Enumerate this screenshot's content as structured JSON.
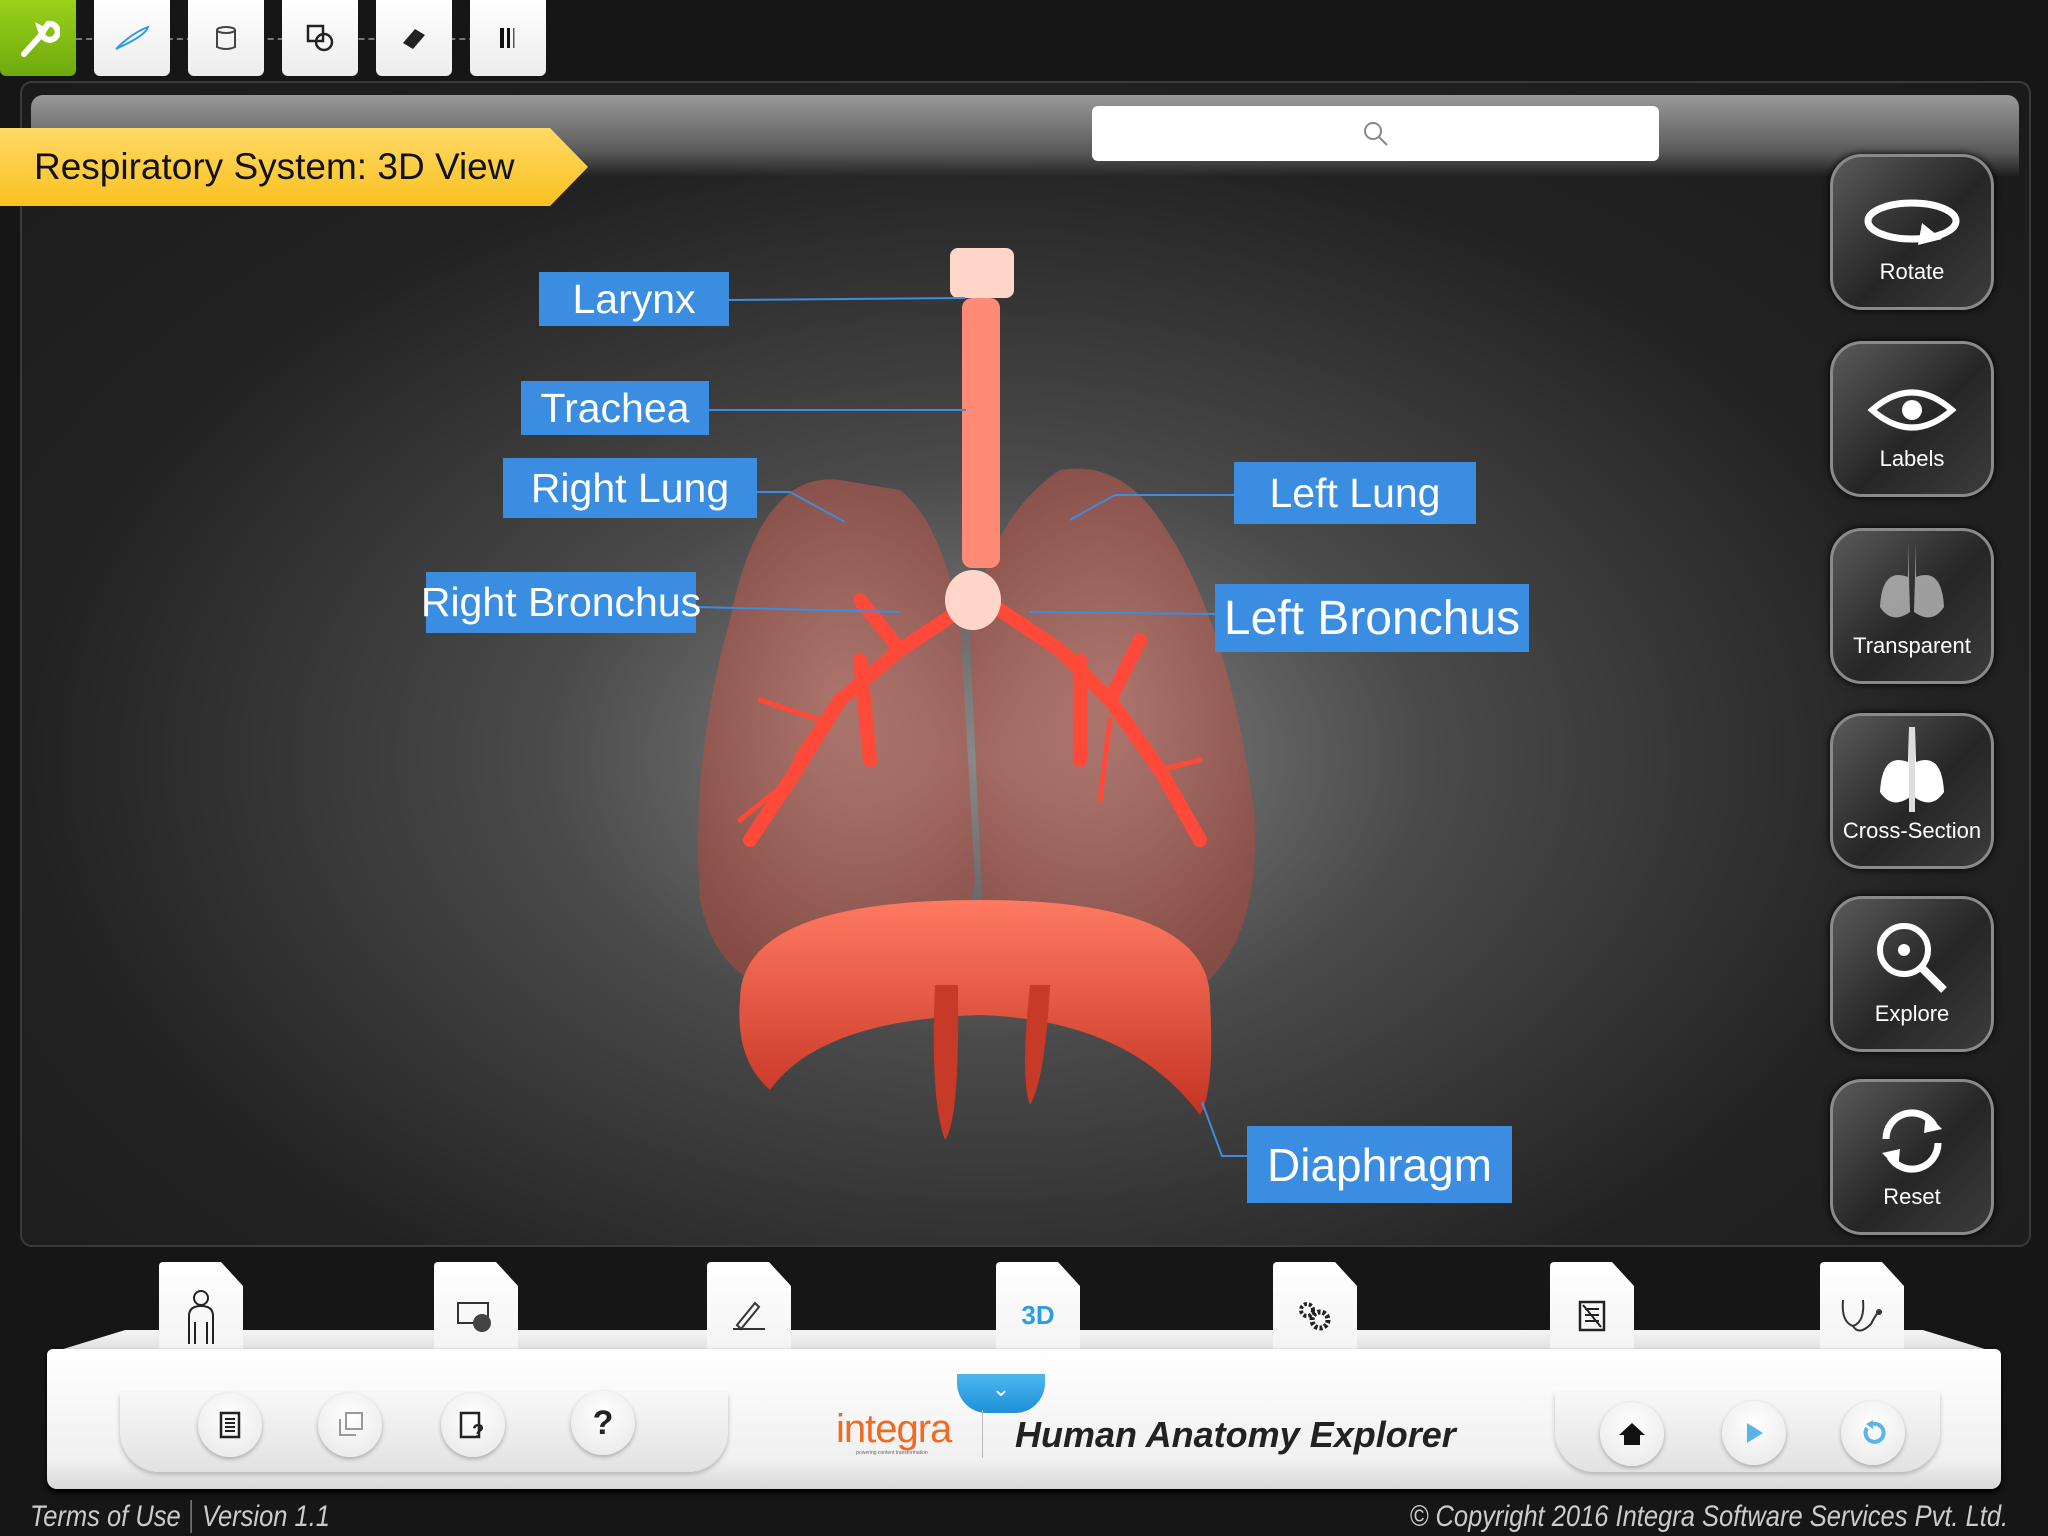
{
  "toolbar": {
    "tools": [
      {
        "icon": "wrench-icon",
        "active": true
      },
      {
        "icon": "pen-icon"
      },
      {
        "icon": "bucket-icon"
      },
      {
        "icon": "shapes-icon"
      },
      {
        "icon": "eraser-icon"
      },
      {
        "icon": "line-width-icon"
      }
    ]
  },
  "header": {
    "title": "Respiratory System: 3D View",
    "search_placeholder": ""
  },
  "labels": {
    "larynx": "Larynx",
    "trachea": "Trachea",
    "right_lung": "Right Lung",
    "right_bronchus": "Right Bronchus",
    "left_lung": "Left Lung",
    "left_bronchus": "Left Bronchus",
    "diaphragm": "Diaphragm"
  },
  "side_buttons": {
    "rotate": "Rotate",
    "labels": "Labels",
    "transparent": "Transparent",
    "cross_section": "Cross-Section",
    "explore": "Explore",
    "reset": "Reset"
  },
  "dock": {
    "tabs": [
      "body-icon",
      "video-icon",
      "write-icon",
      "3D",
      "gears-icon",
      "notes-icon",
      "stethoscope-icon"
    ],
    "tab_3d": "3D",
    "active_tab": "3D",
    "help": "?",
    "logo": "integra",
    "logo_tagline": "powering content transformation",
    "app_title": "Human Anatomy Explorer"
  },
  "footer": {
    "terms": "Terms of Use",
    "version": "Version 1.1",
    "copyright": "© Copyright 2016 Integra Software Services Pvt. Ltd."
  },
  "colors": {
    "label_bg": "#3a8de0",
    "banner": "#f9c221",
    "active_tool": "#8cc316",
    "accent": "#2a9fe0",
    "organ": "#ff5a40"
  }
}
